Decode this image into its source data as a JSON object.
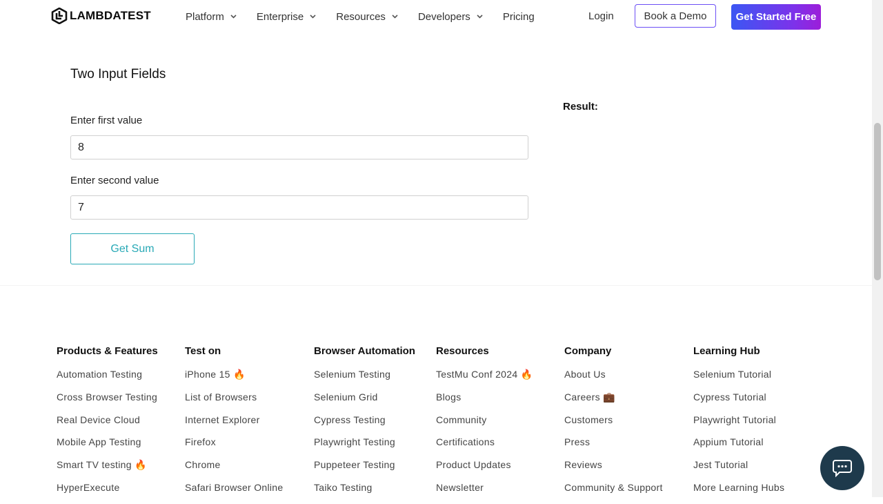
{
  "header": {
    "logo_text": "LAMBDATEST",
    "nav": [
      {
        "label": "Platform",
        "has_dropdown": true
      },
      {
        "label": "Enterprise",
        "has_dropdown": true
      },
      {
        "label": "Resources",
        "has_dropdown": true
      },
      {
        "label": "Developers",
        "has_dropdown": true
      },
      {
        "label": "Pricing",
        "has_dropdown": false
      }
    ],
    "login_label": "Login",
    "demo_label": "Book a Demo",
    "start_label": "Get Started Free"
  },
  "form": {
    "title": "Two Input Fields",
    "first_label": "Enter first value",
    "first_value": "8",
    "second_label": "Enter second value",
    "second_value": "7",
    "button_label": "Get Sum",
    "result_label": "Result:"
  },
  "footer": {
    "columns": [
      {
        "heading": "Products & Features",
        "links": [
          "Automation Testing",
          "Cross Browser Testing",
          "Real Device Cloud",
          "Mobile App Testing",
          "Smart TV testing 🔥",
          "HyperExecute"
        ]
      },
      {
        "heading": "Test on",
        "links": [
          "iPhone 15 🔥",
          "List of Browsers",
          "Internet Explorer",
          "Firefox",
          "Chrome",
          "Safari Browser Online"
        ]
      },
      {
        "heading": "Browser Automation",
        "links": [
          "Selenium Testing",
          "Selenium Grid",
          "Cypress Testing",
          "Playwright Testing",
          "Puppeteer Testing",
          "Taiko Testing"
        ]
      },
      {
        "heading": "Resources",
        "links": [
          "TestMu Conf 2024 🔥",
          "Blogs",
          "Community",
          "Certifications",
          "Product Updates",
          "Newsletter"
        ]
      },
      {
        "heading": "Company",
        "links": [
          "About Us",
          "Careers 💼",
          "Customers",
          "Press",
          "Reviews",
          "Community & Support"
        ]
      },
      {
        "heading": "Learning Hub",
        "links": [
          "Selenium Tutorial",
          "Cypress Tutorial",
          "Playwright Tutorial",
          "Appium Tutorial",
          "Jest Tutorial",
          "More Learning Hubs"
        ]
      }
    ]
  },
  "colors": {
    "brand_gradient_start": "#3b57f3",
    "brand_gradient_end": "#9c1ed9",
    "accent_teal": "#28a9b6",
    "chat_bg": "#1e3a4c"
  }
}
